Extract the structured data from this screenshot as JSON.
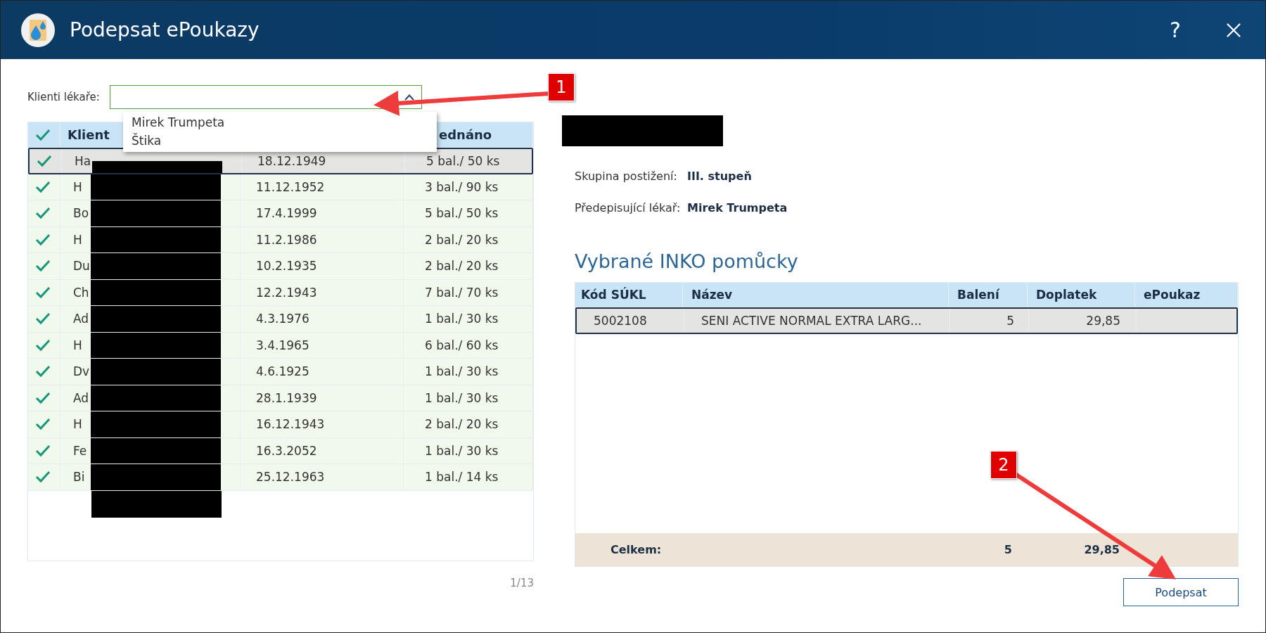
{
  "window": {
    "title": "Podepsat ePoukazy",
    "help": "?"
  },
  "filter": {
    "label": "Klienti lékaře:",
    "expanded": true,
    "options": [
      "Mirek Trumpeta",
      "Štika"
    ]
  },
  "clients": {
    "all_checked": true,
    "columns": [
      "Klient",
      "ednáno"
    ],
    "rows": [
      {
        "checked": true,
        "client": "Ha",
        "born": "18.12.1949",
        "delivered": "5 bal./ 50 ks",
        "selected": true
      },
      {
        "checked": true,
        "client": "H",
        "born": "11.12.1952",
        "delivered": "3 bal./ 90 ks",
        "selected": false
      },
      {
        "checked": true,
        "client": "Bo",
        "born": "17.4.1999",
        "delivered": "5 bal./ 50 ks",
        "selected": false
      },
      {
        "checked": true,
        "client": "H",
        "born": "11.2.1986",
        "delivered": "2 bal./ 20 ks",
        "selected": false
      },
      {
        "checked": true,
        "client": "Du",
        "born": "10.2.1935",
        "delivered": "2 bal./ 20 ks",
        "selected": false
      },
      {
        "checked": true,
        "client": "Ch",
        "born": "12.2.1943",
        "delivered": "7 bal./ 70 ks",
        "selected": false
      },
      {
        "checked": true,
        "client": "Ad",
        "born": "4.3.1976",
        "delivered": "1 bal./ 30 ks",
        "selected": false
      },
      {
        "checked": true,
        "client": "H",
        "born": "3.4.1965",
        "delivered": "6 bal./ 60 ks",
        "selected": false
      },
      {
        "checked": true,
        "client": "Dv",
        "born": "4.6.1925",
        "delivered": "1 bal./ 30 ks",
        "selected": false
      },
      {
        "checked": true,
        "client": "Ad",
        "born": "28.1.1939",
        "delivered": "1 bal./ 30 ks",
        "selected": false
      },
      {
        "checked": true,
        "client": "H",
        "born": "16.12.1943",
        "delivered": "2 bal./ 20 ks",
        "selected": false
      },
      {
        "checked": true,
        "client": "Fe",
        "born": "16.3.2052",
        "delivered": "1 bal./ 30 ks",
        "selected": false
      },
      {
        "checked": true,
        "client": "Bi",
        "born": "25.12.1963",
        "delivered": "1 bal./ 14 ks",
        "selected": false
      }
    ],
    "pager": "1/13"
  },
  "detail": {
    "info": [
      {
        "label": "Skupina postižení:",
        "value": "III. stupeň"
      },
      {
        "label": "Předepisující lékař:",
        "value": "Mirek Trumpeta"
      }
    ],
    "heading": "Vybrané INKO pomůcky",
    "table": {
      "columns": [
        "Kód SÚKL",
        "Název",
        "Balení",
        "Doplatek",
        "ePoukaz"
      ],
      "rows": [
        {
          "code": "5002108",
          "name": "SENI ACTIVE NORMAL EXTRA LARG...",
          "packs": "5",
          "copay": "29,85",
          "selected": true
        }
      ],
      "total": {
        "label": "Celkem:",
        "packs": "5",
        "copay": "29,85"
      }
    },
    "button": "Podepsat"
  },
  "annotations": [
    "1",
    "2"
  ]
}
